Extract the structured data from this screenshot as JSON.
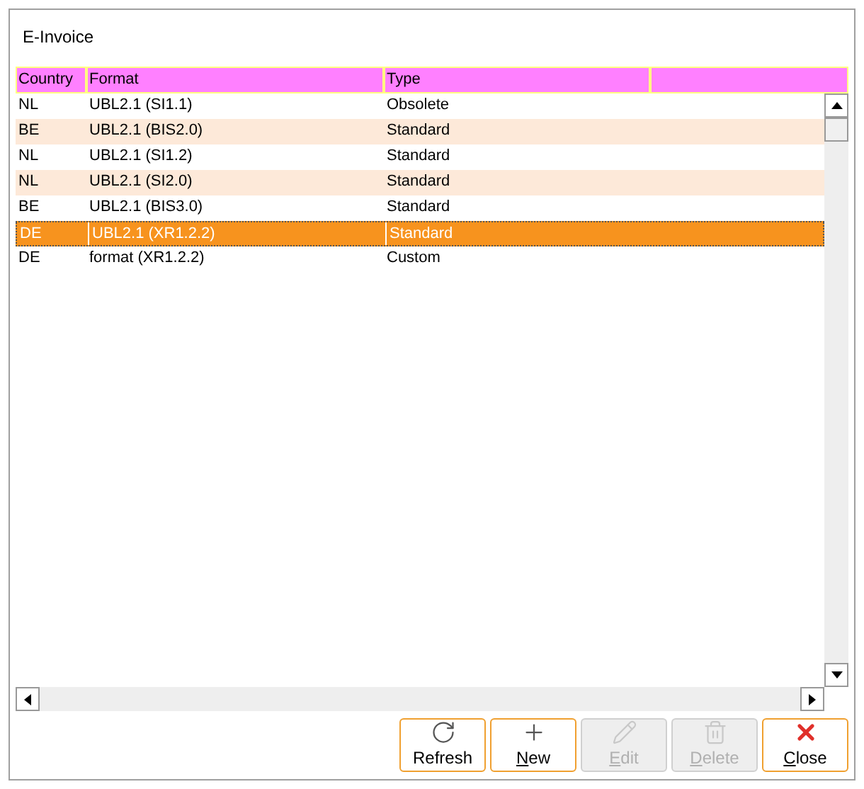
{
  "window": {
    "title": "E-Invoice"
  },
  "table": {
    "columns": [
      "Country",
      "Format",
      "Type"
    ],
    "rows": [
      {
        "cells": [
          "NL",
          "UBL2.1 (SI1.1)",
          "Obsolete"
        ],
        "selected": false
      },
      {
        "cells": [
          "BE",
          "UBL2.1 (BIS2.0)",
          "Standard"
        ],
        "selected": false
      },
      {
        "cells": [
          "NL",
          "UBL2.1 (SI1.2)",
          "Standard"
        ],
        "selected": false
      },
      {
        "cells": [
          "NL",
          "UBL2.1 (SI2.0)",
          "Standard"
        ],
        "selected": false
      },
      {
        "cells": [
          "BE",
          "UBL2.1 (BIS3.0)",
          "Standard"
        ],
        "selected": false
      },
      {
        "cells": [
          "DE",
          "UBL2.1 (XR1.2.2)",
          "Standard"
        ],
        "selected": true
      },
      {
        "cells": [
          "DE",
          "format (XR1.2.2)",
          "Custom"
        ],
        "selected": false
      }
    ]
  },
  "buttons": [
    {
      "kind": "refresh",
      "rest": "Refresh",
      "disabled": false
    },
    {
      "kind": "new",
      "first": "N",
      "rest": "ew",
      "disabled": false
    },
    {
      "kind": "edit",
      "first": "E",
      "rest": "dit",
      "disabled": true
    },
    {
      "kind": "delete",
      "first": "D",
      "rest": "elete",
      "disabled": true
    },
    {
      "kind": "close",
      "first": "C",
      "rest": "lose",
      "disabled": false
    }
  ]
}
